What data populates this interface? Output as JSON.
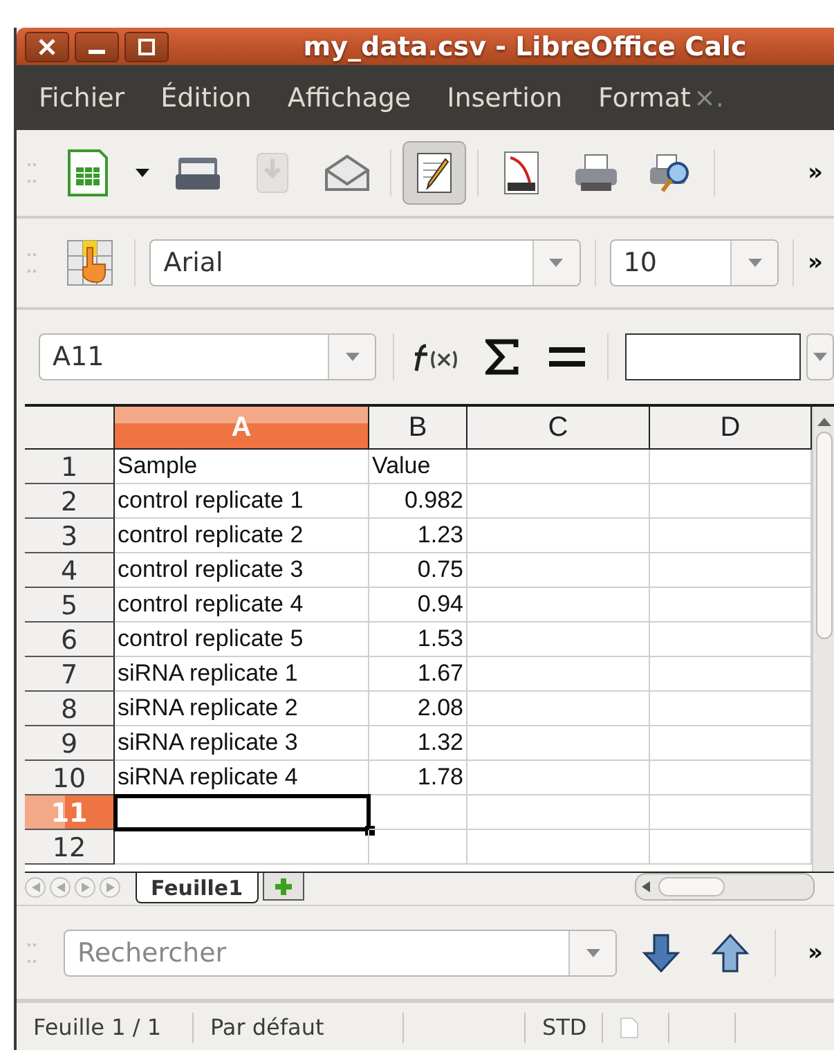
{
  "window": {
    "title": "my_data.csv - LibreOffice Calc"
  },
  "menu": [
    {
      "label": "Fichier",
      "kind": "menu"
    },
    {
      "label": "Édition",
      "kind": "menu"
    },
    {
      "label": "Affichage",
      "kind": "menu"
    },
    {
      "label": "Insertion",
      "kind": "menu"
    },
    {
      "label": "Format",
      "kind": "menu"
    },
    {
      "label": "×.",
      "kind": "overflow"
    }
  ],
  "standard_toolbar": {
    "more": "»",
    "buttons": [
      {
        "kind": "new",
        "pressed": false,
        "disabled": false
      },
      {
        "kind": "caret",
        "pressed": false,
        "disabled": false
      },
      {
        "kind": "open",
        "pressed": false,
        "disabled": false
      },
      {
        "kind": "save",
        "pressed": false,
        "disabled": true
      },
      {
        "kind": "email",
        "pressed": false,
        "disabled": false
      },
      {
        "kind": "edit",
        "pressed": true,
        "disabled": false
      },
      {
        "kind": "pdf",
        "pressed": false,
        "disabled": false
      },
      {
        "kind": "print",
        "pressed": false,
        "disabled": false
      },
      {
        "kind": "preview",
        "pressed": false,
        "disabled": false
      }
    ]
  },
  "format_toolbar": {
    "font_name": "Arial",
    "font_size": "10",
    "more": "»"
  },
  "formula_bar": {
    "name_box": "A11"
  },
  "grid": {
    "columns": [
      {
        "label": "A",
        "selected": true
      },
      {
        "label": "B",
        "selected": false
      },
      {
        "label": "C",
        "selected": false
      },
      {
        "label": "D",
        "selected": false
      }
    ],
    "rows": [
      {
        "label": "1",
        "selected": false,
        "cells": [
          {
            "text": "Sample",
            "numeric": false
          },
          {
            "text": "Value",
            "numeric": false
          }
        ]
      },
      {
        "label": "2",
        "selected": false,
        "cells": [
          {
            "text": "control replicate 1",
            "numeric": false
          },
          {
            "text": "0.982",
            "numeric": true
          }
        ]
      },
      {
        "label": "3",
        "selected": false,
        "cells": [
          {
            "text": "control replicate 2",
            "numeric": false
          },
          {
            "text": "1.23",
            "numeric": true
          }
        ]
      },
      {
        "label": "4",
        "selected": false,
        "cells": [
          {
            "text": "control replicate 3",
            "numeric": false
          },
          {
            "text": "0.75",
            "numeric": true
          }
        ]
      },
      {
        "label": "5",
        "selected": false,
        "cells": [
          {
            "text": "control replicate 4",
            "numeric": false
          },
          {
            "text": "0.94",
            "numeric": true
          }
        ]
      },
      {
        "label": "6",
        "selected": false,
        "cells": [
          {
            "text": "control replicate 5",
            "numeric": false
          },
          {
            "text": "1.53",
            "numeric": true
          }
        ]
      },
      {
        "label": "7",
        "selected": false,
        "cells": [
          {
            "text": "siRNA replicate 1",
            "numeric": false
          },
          {
            "text": "1.67",
            "numeric": true
          }
        ]
      },
      {
        "label": "8",
        "selected": false,
        "cells": [
          {
            "text": "siRNA replicate 2",
            "numeric": false
          },
          {
            "text": "2.08",
            "numeric": true
          }
        ]
      },
      {
        "label": "9",
        "selected": false,
        "cells": [
          {
            "text": "siRNA replicate 3",
            "numeric": false
          },
          {
            "text": "1.32",
            "numeric": true
          }
        ]
      },
      {
        "label": "10",
        "selected": false,
        "cells": [
          {
            "text": "siRNA replicate 4",
            "numeric": false
          },
          {
            "text": "1.78",
            "numeric": true
          }
        ]
      },
      {
        "label": "11",
        "selected": true
      },
      {
        "label": "12",
        "selected": false
      }
    ]
  },
  "sheet_tabs": [
    {
      "label": "Feuille1",
      "selected": true
    }
  ],
  "find_toolbar": {
    "placeholder": "Rechercher",
    "more": "»"
  },
  "status_bar": {
    "sheet": "Feuille 1 / 1",
    "page_style": "Par défaut",
    "selection_mode": "STD"
  }
}
